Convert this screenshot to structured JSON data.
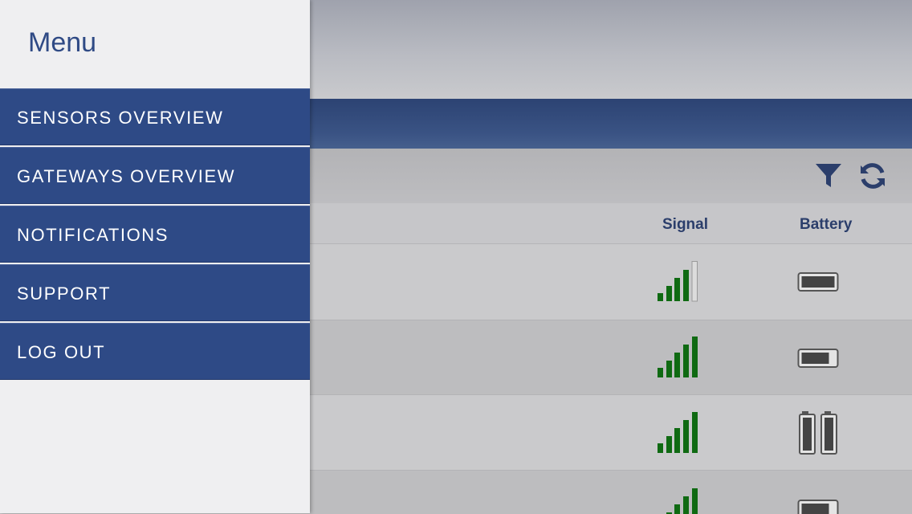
{
  "menu": {
    "title": "Menu",
    "items": [
      {
        "label": "SENSORS OVERVIEW"
      },
      {
        "label": "GATEWAYS OVERVIEW"
      },
      {
        "label": "NOTIFICATIONS"
      },
      {
        "label": "SUPPORT"
      },
      {
        "label": "LOG OUT"
      }
    ]
  },
  "toolbar": {
    "icons": [
      "filter-icon",
      "refresh-icon"
    ]
  },
  "table": {
    "columns": {
      "signal": "Signal",
      "battery": "Battery"
    },
    "rows": [
      {
        "signal_bars": 4,
        "battery": "horizontal"
      },
      {
        "signal_bars": 5,
        "battery": "horizontal"
      },
      {
        "signal_bars": 5,
        "battery": "vertical-pair"
      },
      {
        "signal_bars": 5,
        "battery": "horizontal"
      }
    ]
  },
  "colors": {
    "brand_blue": "#2e4a86",
    "signal_green": "#0f6a12",
    "header_text": "#2b3e6b"
  }
}
